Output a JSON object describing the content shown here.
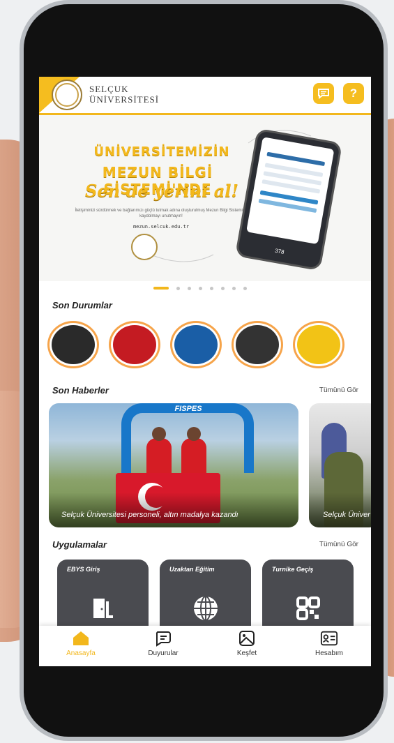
{
  "header": {
    "logo_line1": "SELÇUK",
    "logo_line2": "ÜNİVERSİTESİ",
    "chat_icon": "chat-icon",
    "help_label": "?"
  },
  "banner": {
    "line1": "ÜNİVERSİTEMİZİN",
    "line2": "MEZUN BİLGİ SİSTEMİ'NDE",
    "line3": "Sen de yerini al!",
    "small_text": "İletişiminizi sürdürmek ve bağlarımızı güçlü tutmak adına oluşturulmuş Mezun Bilgi Sistemine kaydolmayı unutmayın!",
    "url": "mezun.selcuk.edu.tr",
    "phone_count": "378"
  },
  "carousel": {
    "total": 9,
    "active": 0
  },
  "stories": {
    "title": "Son Durumlar",
    "items": [
      {
        "name": "story-1",
        "color": "#2a2a2a"
      },
      {
        "name": "story-2",
        "color": "#c41b22"
      },
      {
        "name": "story-3",
        "color": "#1a5ea6"
      },
      {
        "name": "story-4",
        "color": "#333333"
      },
      {
        "name": "story-5",
        "color": "#f2c316"
      }
    ]
  },
  "news": {
    "title": "Son Haberler",
    "see_all": "Tümünü Gör",
    "items": [
      {
        "caption": "Selçuk Üniversitesi personeli, altın madalya kazandı",
        "arch_text": "FISPES"
      },
      {
        "caption": "Selçuk Üniver"
      }
    ]
  },
  "apps": {
    "title": "Uygulamalar",
    "see_all": "Tümünü Gör",
    "items": [
      {
        "label": "EBYS Giriş",
        "icon": "door-icon"
      },
      {
        "label": "Uzaktan Eğitim",
        "icon": "globe-icon"
      },
      {
        "label": "Turnike Geçiş",
        "icon": "qr-code-icon"
      }
    ]
  },
  "tabs": [
    {
      "label": "Anasayfa",
      "icon": "home-icon",
      "active": true
    },
    {
      "label": "Duyurular",
      "icon": "announcement-icon",
      "active": false
    },
    {
      "label": "Keşfet",
      "icon": "image-icon",
      "active": false
    },
    {
      "label": "Hesabım",
      "icon": "profile-card-icon",
      "active": false
    }
  ],
  "colors": {
    "accent": "#f2b71c",
    "app_tile": "#4a4b50"
  }
}
